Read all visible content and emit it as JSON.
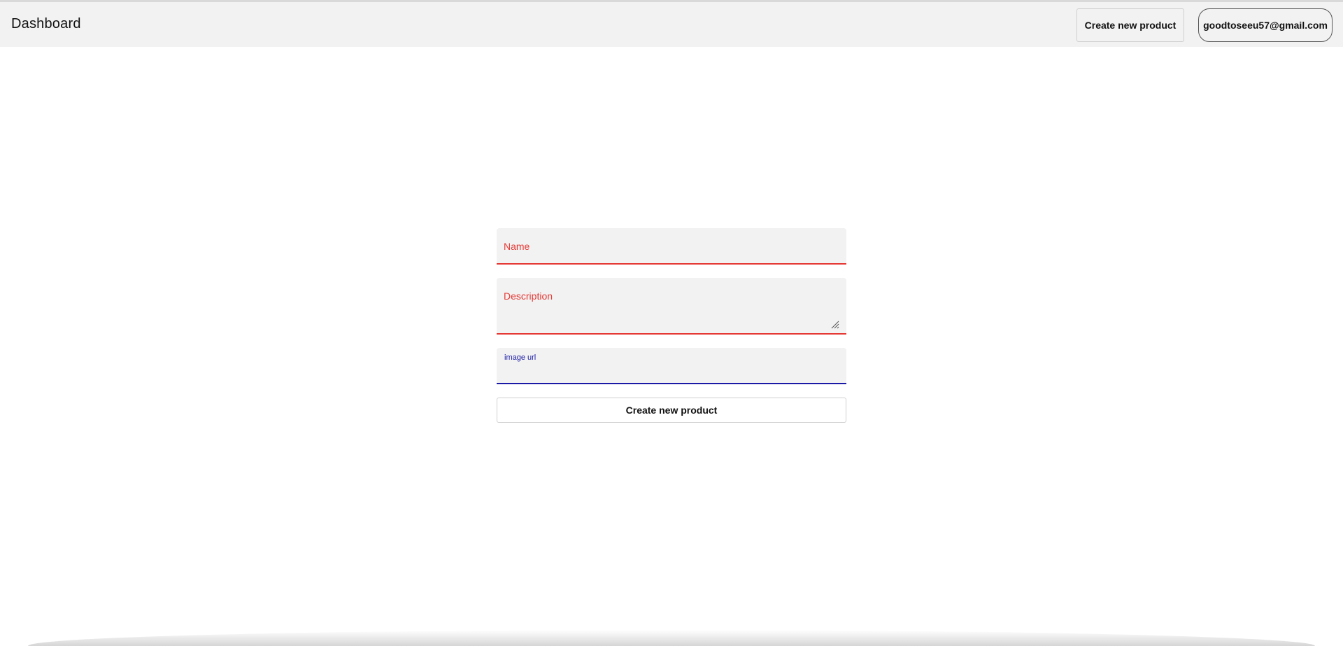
{
  "header": {
    "title": "Dashboard",
    "create_button_label": "Create new product",
    "user_email": "goodtoseeu57@gmail.com"
  },
  "form": {
    "name_label": "Name",
    "description_label": "Description",
    "image_url_label": "image url",
    "submit_label": "Create new product"
  },
  "colors": {
    "error": "#e53935",
    "focus": "#1a1aa6",
    "header_bg": "#f2f2f2"
  }
}
